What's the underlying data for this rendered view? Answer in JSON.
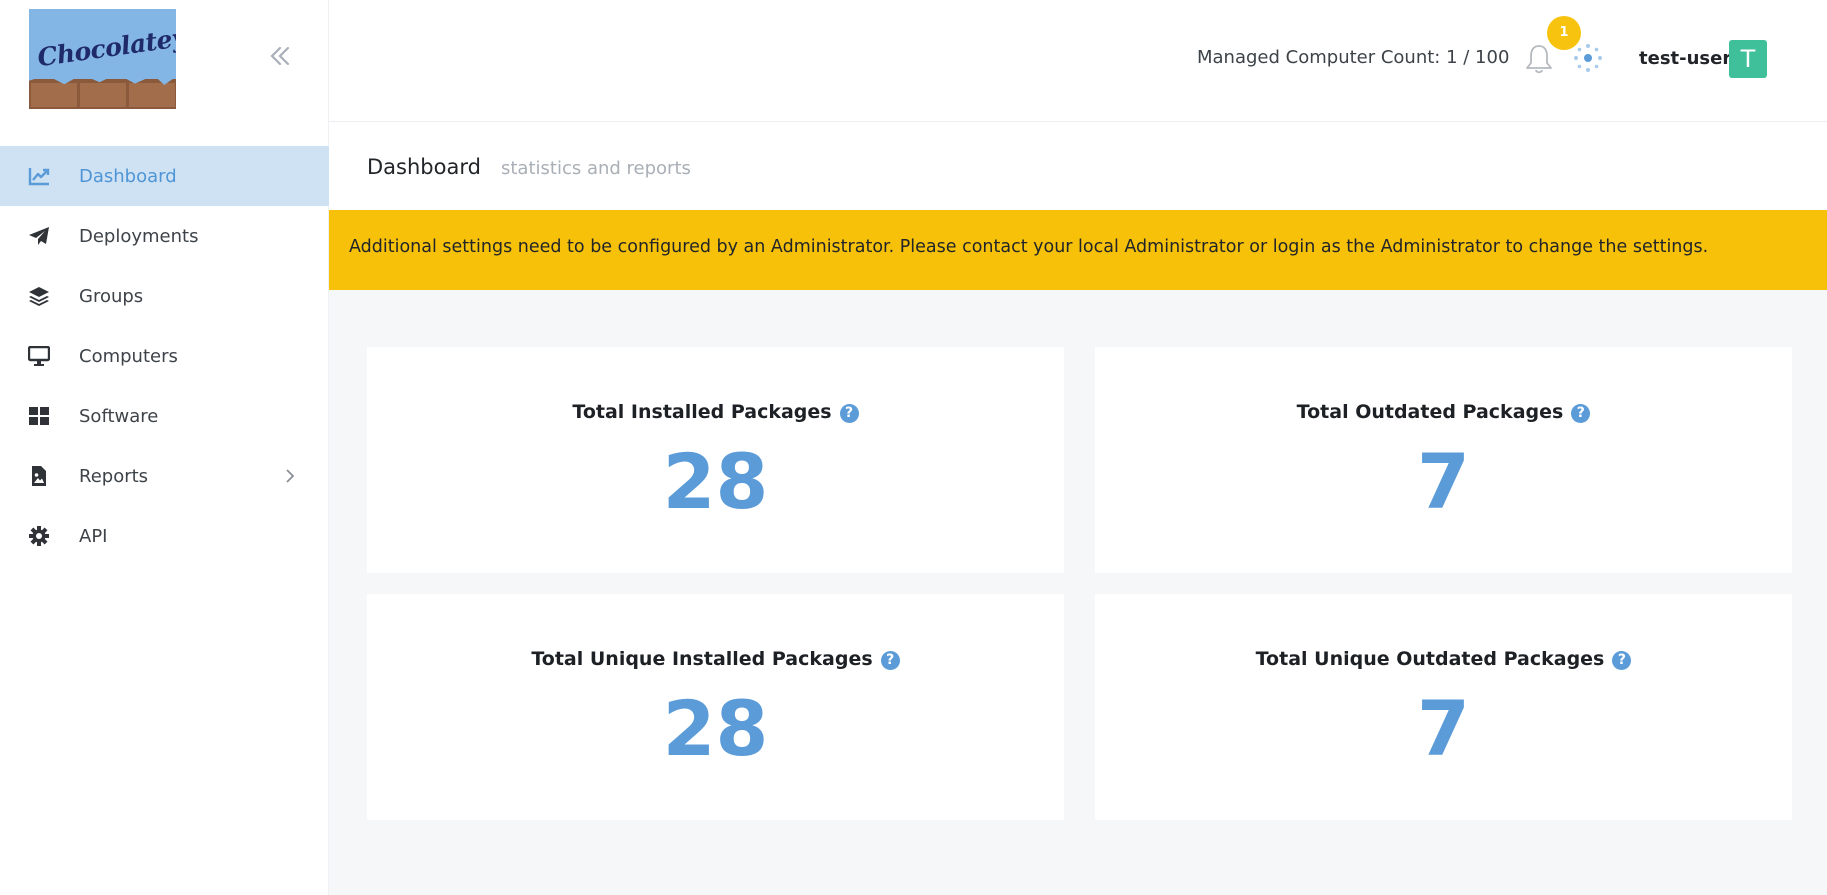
{
  "brand": {
    "logo_text": "Chocolatey"
  },
  "sidebar": {
    "items": [
      {
        "label": "Dashboard",
        "icon": "chart-line-icon",
        "active": true
      },
      {
        "label": "Deployments",
        "icon": "paper-plane-icon"
      },
      {
        "label": "Groups",
        "icon": "layers-icon"
      },
      {
        "label": "Computers",
        "icon": "desktop-icon"
      },
      {
        "label": "Software",
        "icon": "grid-icon"
      },
      {
        "label": "Reports",
        "icon": "file-image-icon",
        "has_submenu": true
      },
      {
        "label": "API",
        "icon": "gear-icon"
      }
    ]
  },
  "header": {
    "managed_count": "Managed Computer Count: 1 / 100",
    "notification_count": "1",
    "username": "test-user",
    "avatar_initial": "T"
  },
  "page": {
    "title": "Dashboard",
    "subtitle": "statistics and reports"
  },
  "alert": {
    "text": "Additional settings need to be configured by an Administrator. Please contact your local Administrator or login as the Administrator to change the settings."
  },
  "stats": [
    {
      "title": "Total Installed Packages",
      "value": "28"
    },
    {
      "title": "Total Outdated Packages",
      "value": "7"
    },
    {
      "title": "Total Unique Installed Packages",
      "value": "28"
    },
    {
      "title": "Total Unique Outdated Packages",
      "value": "7"
    }
  ],
  "colors": {
    "accent": "#5a9bd8",
    "active_bg": "#cfe2f3",
    "alert_bg": "#f8c109",
    "badge": "#f8c30e",
    "avatar": "#3fbf9a"
  }
}
